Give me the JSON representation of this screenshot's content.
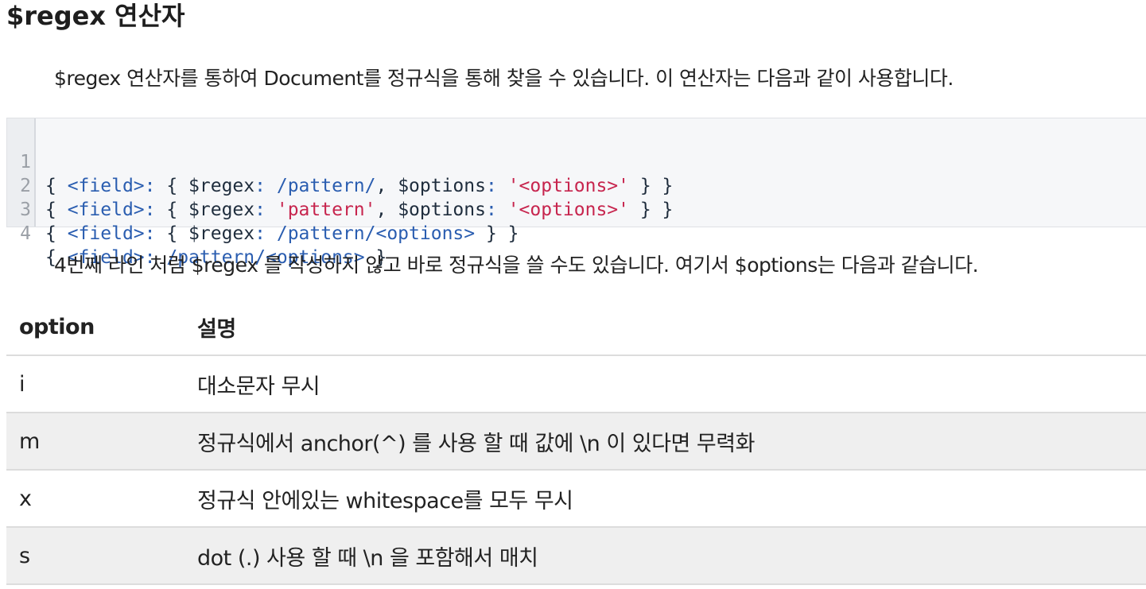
{
  "title": "$regex 연산자",
  "intro": "$regex 연산자를 통하여 Document를 정규식을 통해 찾을 수 있습니다. 이 연산자는 다음과 같이 사용합니다.",
  "code": {
    "line_numbers": [
      "1",
      "2",
      "3",
      "4"
    ],
    "lines": [
      [
        {
          "t": "punc",
          "s": "{ "
        },
        {
          "t": "field",
          "s": "<field>"
        },
        {
          "t": "colon",
          "s": ":"
        },
        {
          "t": "punc",
          "s": " { "
        },
        {
          "t": "key",
          "s": "$regex"
        },
        {
          "t": "colon",
          "s": ":"
        },
        {
          "t": "punc",
          "s": " "
        },
        {
          "t": "re",
          "s": "/pattern/"
        },
        {
          "t": "punc",
          "s": ", "
        },
        {
          "t": "key",
          "s": "$options"
        },
        {
          "t": "colon",
          "s": ":"
        },
        {
          "t": "punc",
          "s": " "
        },
        {
          "t": "str",
          "s": "'<options>'"
        },
        {
          "t": "punc",
          "s": " } }"
        }
      ],
      [
        {
          "t": "punc",
          "s": "{ "
        },
        {
          "t": "field",
          "s": "<field>"
        },
        {
          "t": "colon",
          "s": ":"
        },
        {
          "t": "punc",
          "s": " { "
        },
        {
          "t": "key",
          "s": "$regex"
        },
        {
          "t": "colon",
          "s": ":"
        },
        {
          "t": "punc",
          "s": " "
        },
        {
          "t": "str",
          "s": "'pattern'"
        },
        {
          "t": "punc",
          "s": ", "
        },
        {
          "t": "key",
          "s": "$options"
        },
        {
          "t": "colon",
          "s": ":"
        },
        {
          "t": "punc",
          "s": " "
        },
        {
          "t": "str",
          "s": "'<options>'"
        },
        {
          "t": "punc",
          "s": " } }"
        }
      ],
      [
        {
          "t": "punc",
          "s": "{ "
        },
        {
          "t": "field",
          "s": "<field>"
        },
        {
          "t": "colon",
          "s": ":"
        },
        {
          "t": "punc",
          "s": " { "
        },
        {
          "t": "key",
          "s": "$regex"
        },
        {
          "t": "colon",
          "s": ":"
        },
        {
          "t": "punc",
          "s": " "
        },
        {
          "t": "re",
          "s": "/pattern/<options>"
        },
        {
          "t": "punc",
          "s": " } }"
        }
      ],
      [
        {
          "t": "punc",
          "s": "{ "
        },
        {
          "t": "field",
          "s": "<field>"
        },
        {
          "t": "colon",
          "s": ":"
        },
        {
          "t": "punc",
          "s": " "
        },
        {
          "t": "re",
          "s": "/pattern/<options>"
        },
        {
          "t": "punc",
          "s": " }"
        }
      ]
    ]
  },
  "note": "4번째 라인 처럼 $regex 를 작성하지 않고 바로 정규식을 쓸 수도 있습니다. 여기서 $options는 다음과 같습니다.",
  "table": {
    "headers": [
      "option",
      "설명"
    ],
    "rows": [
      [
        "i",
        "대소문자 무시"
      ],
      [
        "m",
        "정규식에서 anchor(^) 를 사용 할 때 값에 \\n 이 있다면 무력화"
      ],
      [
        "x",
        "정규식 안에있는 whitespace를 모두 무시"
      ],
      [
        "s",
        "dot (.) 사용 할 때 \\n 을 포함해서 매치"
      ]
    ]
  },
  "colors": {
    "code_field": "#2a5db0",
    "code_string": "#c7254e",
    "code_background": "#f6f7f9",
    "row_alt_background": "#efefef"
  }
}
